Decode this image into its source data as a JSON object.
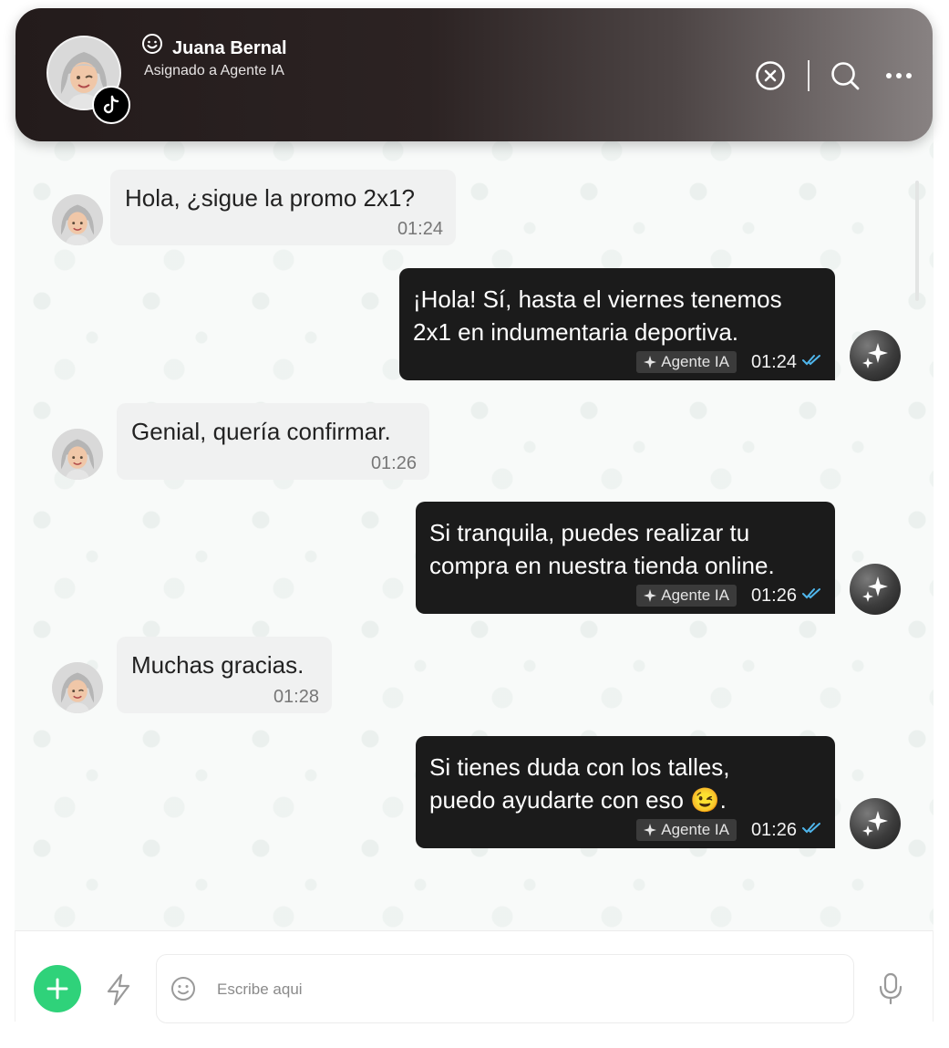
{
  "header": {
    "contact_name": "Juana Bernal",
    "assigned_text": "Asignado a Agente IA",
    "channel_icon": "tiktok-icon",
    "actions": [
      "close-circle-icon",
      "search-icon",
      "more-icon"
    ]
  },
  "messages": [
    {
      "direction": "incoming",
      "text": "Hola, ¿sigue la promo 2x1?",
      "time": "01:24"
    },
    {
      "direction": "outgoing",
      "line1": "¡Hola! Sí, hasta el viernes tenemos",
      "line2": "2x1 en indumentaria deportiva.",
      "agent": "Agente IA",
      "time": "01:24"
    },
    {
      "direction": "incoming",
      "text": "Genial, quería confirmar.",
      "time": "01:26"
    },
    {
      "direction": "outgoing",
      "line1": "Si tranquila, puedes realizar tu",
      "line2": "compra en nuestra tienda online.",
      "agent": "Agente IA",
      "time": "01:26"
    },
    {
      "direction": "incoming",
      "text": "Muchas gracias.",
      "time": "01:28"
    },
    {
      "direction": "outgoing",
      "line1": "Si tienes duda con los talles,",
      "line2": "puedo ayudarte con eso 😉.",
      "agent": "Agente IA",
      "time": "01:26"
    }
  ],
  "composer": {
    "placeholder": "Escribe aqui"
  },
  "colors": {
    "accent_green": "#2fd27a",
    "read_check": "#4fb6ec",
    "outgoing_bubble": "#1b1b1b",
    "incoming_bubble": "#f0f1f1"
  }
}
